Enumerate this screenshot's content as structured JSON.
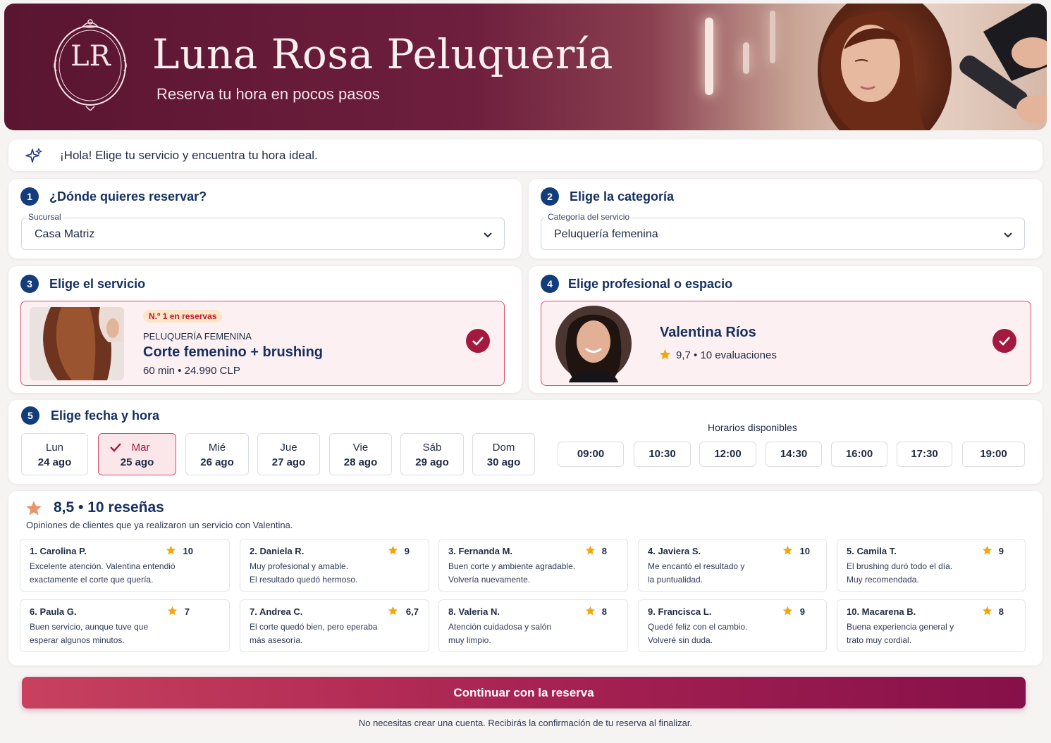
{
  "brand": {
    "name": "Luna Rosa Peluquería",
    "tagline": "Reserva tu hora en pocos pasos",
    "logo_initials": "LR",
    "primary_color": "#a3193f",
    "navy_color": "#133c7a"
  },
  "greeting": "¡Hola! Elige tu servicio y encuentra tu hora ideal.",
  "steps": {
    "location": {
      "number": "1",
      "title": "¿Dónde quieres reservar?",
      "field_label": "Sucursal",
      "value": "Casa Matriz"
    },
    "category": {
      "number": "2",
      "title": "Elige la categoría",
      "field_label": "Categoría del servicio",
      "value": "Peluquería femenina"
    },
    "service": {
      "number": "3",
      "title": "Elige el servicio",
      "badge": "N.º 1 en reservas",
      "category": "PELUQUERÍA FEMENINA",
      "name": "Corte femenino + brushing",
      "details": "60 min • 24.990 CLP"
    },
    "professional": {
      "number": "4",
      "title": "Elige profesional o espacio",
      "name": "Valentina Ríos",
      "rating": "9,7 • 10 evaluaciones"
    },
    "datetime": {
      "number": "5",
      "title": "Elige fecha y hora",
      "days": [
        {
          "weekday": "Lun",
          "date": "24 ago"
        },
        {
          "weekday": "Mar",
          "date": "25 ago"
        },
        {
          "weekday": "Mié",
          "date": "26 ago"
        },
        {
          "weekday": "Jue",
          "date": "27 ago"
        },
        {
          "weekday": "Vie",
          "date": "28 ago"
        },
        {
          "weekday": "Sáb",
          "date": "29 ago"
        },
        {
          "weekday": "Dom",
          "date": "30 ago"
        }
      ],
      "selected_day": "Mar",
      "slots_title": "Horarios disponibles",
      "slots": [
        "09:00",
        "10:30",
        "12:00",
        "14:30",
        "16:00",
        "17:30",
        "19:00"
      ]
    }
  },
  "reviews": {
    "summary": "8,5 • 10 reseñas",
    "subtitle": "Opiniones de clientes que ya realizaron un servicio con Valentina.",
    "items": [
      {
        "name": "1. Carolina P.",
        "score": "10",
        "text1": "Excelente atención. Valentina entendió",
        "text2": "exactamente el corte que quería."
      },
      {
        "name": "2. Daniela R.",
        "score": "9",
        "text1": "Muy profesional y amable.",
        "text2": "El resultado quedó hermoso."
      },
      {
        "name": "3. Fernanda M.",
        "score": "8",
        "text1": "Buen corte y ambiente agradable.",
        "text2": "Volvería nuevamente."
      },
      {
        "name": "4. Javiera S.",
        "score": "10",
        "text1": "Me encantó el resultado y",
        "text2": "la puntualidad."
      },
      {
        "name": "5. Camila T.",
        "score": "9",
        "text1": "El brushing duró todo el día.",
        "text2": "Muy recomendada."
      },
      {
        "name": "6. Paula G.",
        "score": "7",
        "text1": "Buen servicio, aunque tuve que",
        "text2": "esperar algunos minutos."
      },
      {
        "name": "7. Andrea C.",
        "score": "6,7",
        "text1": "El corte quedó bien, pero eperaba",
        "text2": "más asesoría."
      },
      {
        "name": "8. Valeria N.",
        "score": "8",
        "text1": "Atención cuidadosa y salón",
        "text2": "muy limpio."
      },
      {
        "name": "9. Francisca L.",
        "score": "9",
        "text1": "Quedé feliz con el cambio.",
        "text2": "Volveré sin duda."
      },
      {
        "name": "10. Macarena B.",
        "score": "8",
        "text1": "Buena experiencia general y",
        "text2": "trato muy cordial."
      }
    ]
  },
  "cta": {
    "label": "Continuar con la reserva",
    "note": "No necesitas crear una cuenta. Recibirás la confirmación de tu reserva al finalizar."
  }
}
